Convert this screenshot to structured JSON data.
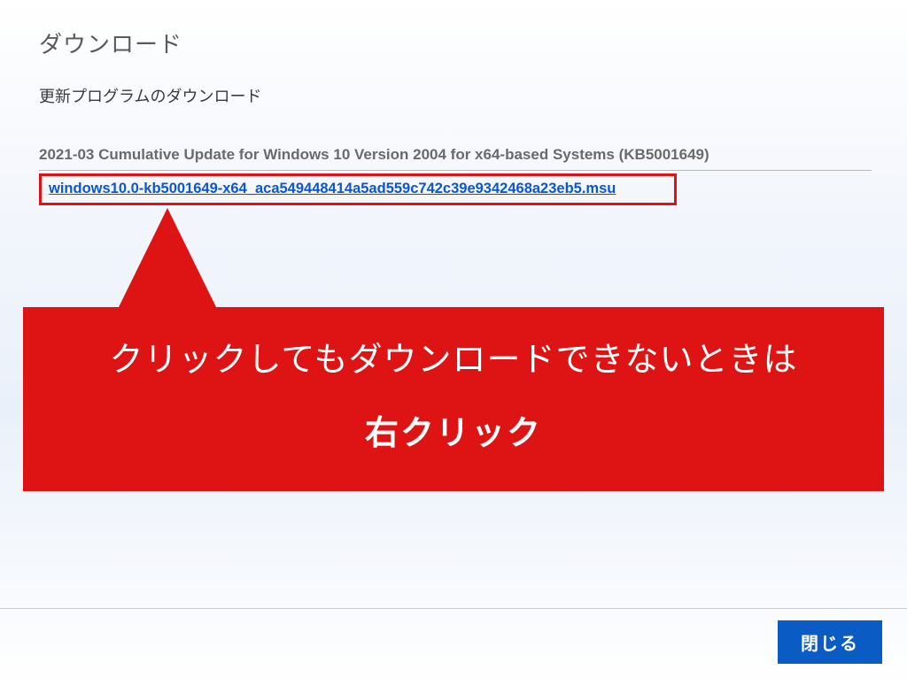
{
  "page": {
    "title": "ダウンロード",
    "subtitle": "更新プログラムのダウンロード"
  },
  "update": {
    "name": "2021-03 Cumulative Update for Windows 10 Version 2004 for x64-based Systems (KB5001649)",
    "file_link": "windows10.0-kb5001649-x64_aca549448414a5ad559c742c39e9342468a23eb5.msu"
  },
  "callout": {
    "line1": "クリックしてもダウンロードできないときは",
    "line2": "右クリック"
  },
  "footer": {
    "close_label": "閉じる"
  },
  "colors": {
    "accent_red": "#de1414",
    "link_blue": "#0b57d0",
    "button_blue": "#0a5bc4"
  }
}
